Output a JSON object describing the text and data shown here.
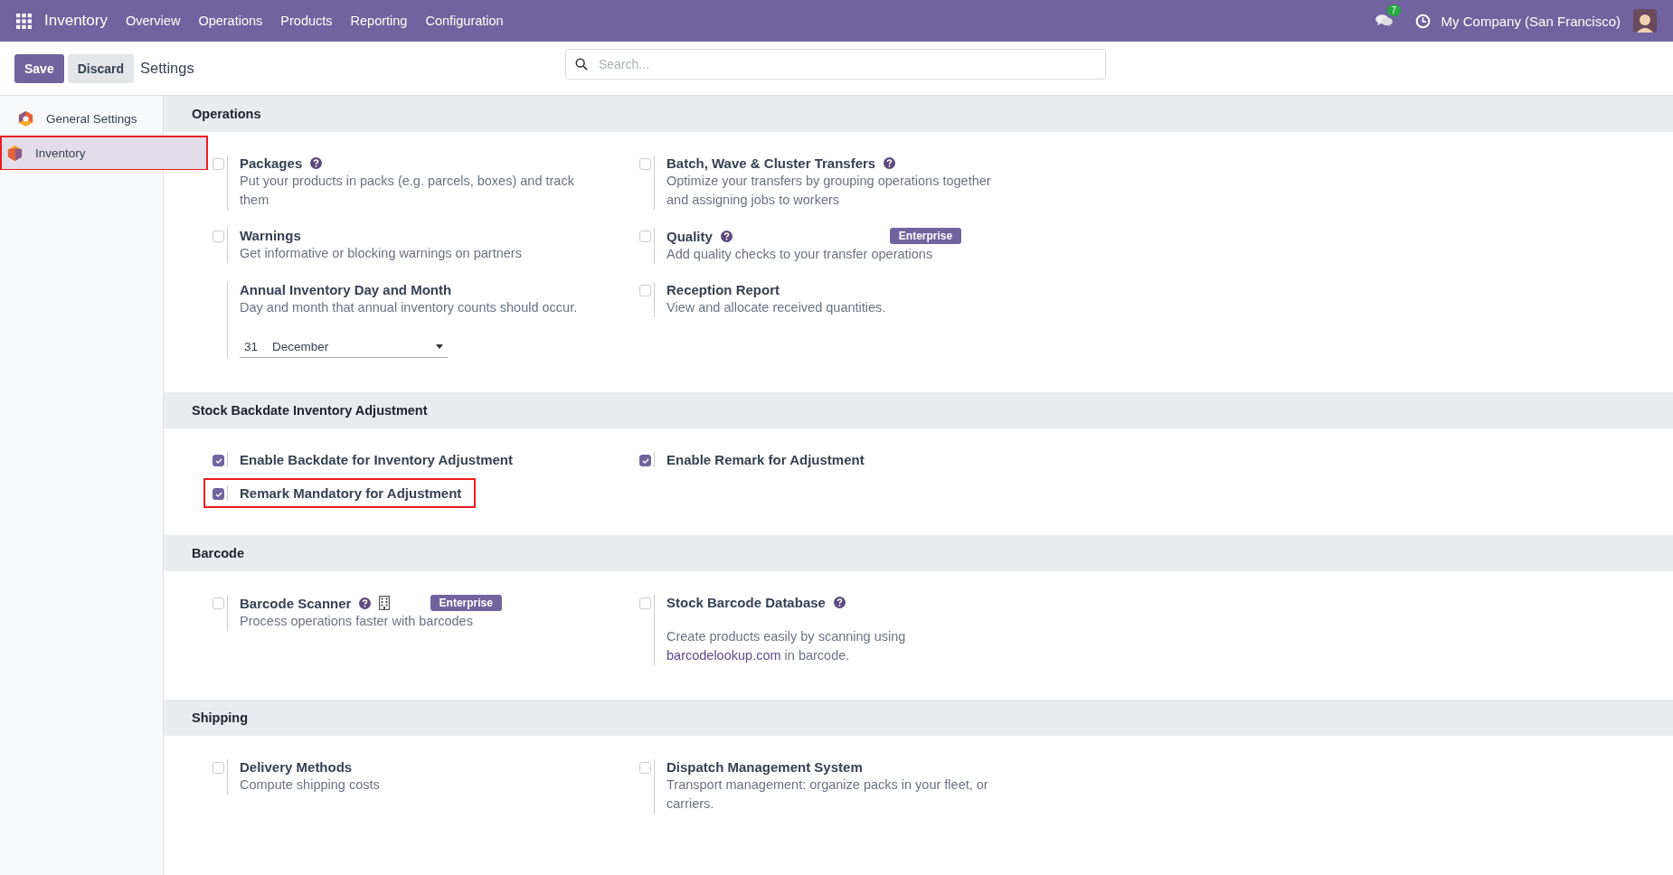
{
  "navbar": {
    "app_name": "Inventory",
    "menu": [
      "Overview",
      "Operations",
      "Products",
      "Reporting",
      "Configuration"
    ],
    "message_count": "7",
    "company": "My Company (San Francisco)"
  },
  "control_panel": {
    "save": "Save",
    "discard": "Discard",
    "title": "Settings",
    "search": {
      "placeholder": "Search..."
    }
  },
  "sidebar": {
    "items": [
      {
        "label": "General Settings",
        "kind": "general",
        "selected": false,
        "highlighted": false
      },
      {
        "label": "Inventory",
        "kind": "inventory",
        "selected": true,
        "highlighted": true
      }
    ]
  },
  "sections": [
    {
      "title": "Operations",
      "settings": [
        {
          "kind": "checkbox",
          "title": "Packages",
          "checked": false,
          "help": true,
          "description": "Put your products in packs (e.g. parcels, boxes) and track them",
          "highlighted": false
        },
        {
          "kind": "checkbox",
          "title": "Batch, Wave & Cluster Transfers",
          "checked": false,
          "help": true,
          "description": "Optimize your transfers by grouping operations together and assigning jobs to workers",
          "highlighted": false
        },
        {
          "kind": "checkbox",
          "title": "Warnings",
          "checked": false,
          "help": false,
          "description": "Get informative or blocking warnings on partners",
          "highlighted": false
        },
        {
          "kind": "checkbox",
          "title": "Quality",
          "checked": false,
          "help": true,
          "badge": "Enterprise",
          "description": "Add quality checks to your transfer operations",
          "highlighted": false
        },
        {
          "kind": "select",
          "title": "Annual Inventory Day and Month",
          "help": false,
          "description": "Day and month that annual inventory counts should occur.",
          "day": "31",
          "month": "December",
          "highlighted": false
        },
        {
          "kind": "checkbox",
          "title": "Reception Report",
          "checked": false,
          "help": false,
          "description": "View and allocate received quantities.",
          "highlighted": false
        }
      ]
    },
    {
      "title": "Stock Backdate Inventory Adjustment",
      "settings": [
        {
          "kind": "checkbox",
          "title": "Enable Backdate for Inventory Adjustment",
          "checked": true,
          "help": false,
          "highlighted": false
        },
        {
          "kind": "checkbox",
          "title": "Enable Remark for Adjustment",
          "checked": true,
          "help": false,
          "highlighted": false
        },
        {
          "kind": "checkbox",
          "title": "Remark Mandatory for Adjustment",
          "checked": true,
          "help": false,
          "highlighted": true
        }
      ]
    },
    {
      "title": "Barcode",
      "settings": [
        {
          "kind": "checkbox",
          "title": "Barcode Scanner",
          "checked": false,
          "help": true,
          "building": true,
          "badge": "Enterprise",
          "description": "Process operations faster with barcodes",
          "highlighted": false
        },
        {
          "kind": "checkbox",
          "title": "Stock Barcode Database",
          "checked": false,
          "help": true,
          "gap": true,
          "description": "Create products easily by scanning using",
          "link": "barcodelookup.com",
          "description_end": "in barcode.",
          "highlighted": false
        }
      ]
    },
    {
      "title": "Shipping",
      "settings": [
        {
          "kind": "checkbox",
          "title": "Delivery Methods",
          "checked": false,
          "help": false,
          "description": "Compute shipping costs",
          "highlighted": false
        },
        {
          "kind": "checkbox",
          "title": "Dispatch Management System",
          "checked": false,
          "help": false,
          "description": "Transport management: organize packs in your fleet, or carriers.",
          "highlighted": false
        }
      ]
    }
  ]
}
